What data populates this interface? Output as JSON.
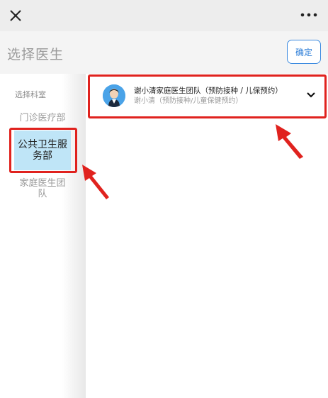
{
  "topbar": {
    "close_icon": "close-icon",
    "more_icon": "more-dots-icon"
  },
  "header": {
    "title": "选择医生",
    "confirm_label": "确定"
  },
  "sidebar": {
    "header": "选择科室",
    "items": [
      {
        "label": "门诊医疗部"
      },
      {
        "label": "公共卫生服务部"
      },
      {
        "label": "家庭医生团队"
      }
    ]
  },
  "doctor": {
    "name": "谢小清家庭医生团队（预防接种 / 儿保预约）",
    "subtitle": "谢小清（预防接种/儿童保健预约）"
  },
  "colors": {
    "accent": "#2f7fd8",
    "active_bg": "#bfe5f7",
    "annotation_red": "#e0221e"
  }
}
